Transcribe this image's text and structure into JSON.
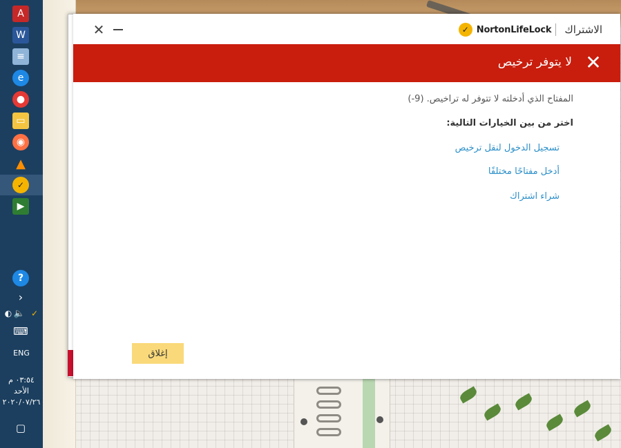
{
  "window": {
    "title": "الاشتراك",
    "brand_name": "NortonLifeLock",
    "close_glyph": "✕",
    "minimize_glyph": "—"
  },
  "header": {
    "title": "لا يتوفر ترخيص",
    "icon": "close-x-icon"
  },
  "body": {
    "message": "المفتاح الذي أدخلته لا تتوفر له تراخيص. (9-)",
    "prompt": "اختر من بين الخيارات التالية:",
    "options": [
      "تسجيل الدخول لنقل ترخيص",
      "أدخل مفتاحًا مختلفًا",
      "شراء اشتراك"
    ]
  },
  "footer": {
    "close_label": "إغلاق"
  },
  "taskbar": {
    "language": "ENG",
    "time": "٠٣:٥٤ م",
    "day": "الأحد",
    "date": "٢٠٢٠/٠٧/٢٦",
    "apps": [
      "pdf-icon",
      "word-icon",
      "notepad-icon",
      "edge-icon",
      "chrome-icon",
      "file-explorer-icon",
      "firefox-icon",
      "vlc-icon",
      "norton-icon",
      "media-player-icon"
    ]
  },
  "colors": {
    "header_red": "#c91d0d",
    "link_blue": "#2b8fc9",
    "button_yellow": "#f9d97a",
    "taskbar": "#1c3f5f"
  }
}
